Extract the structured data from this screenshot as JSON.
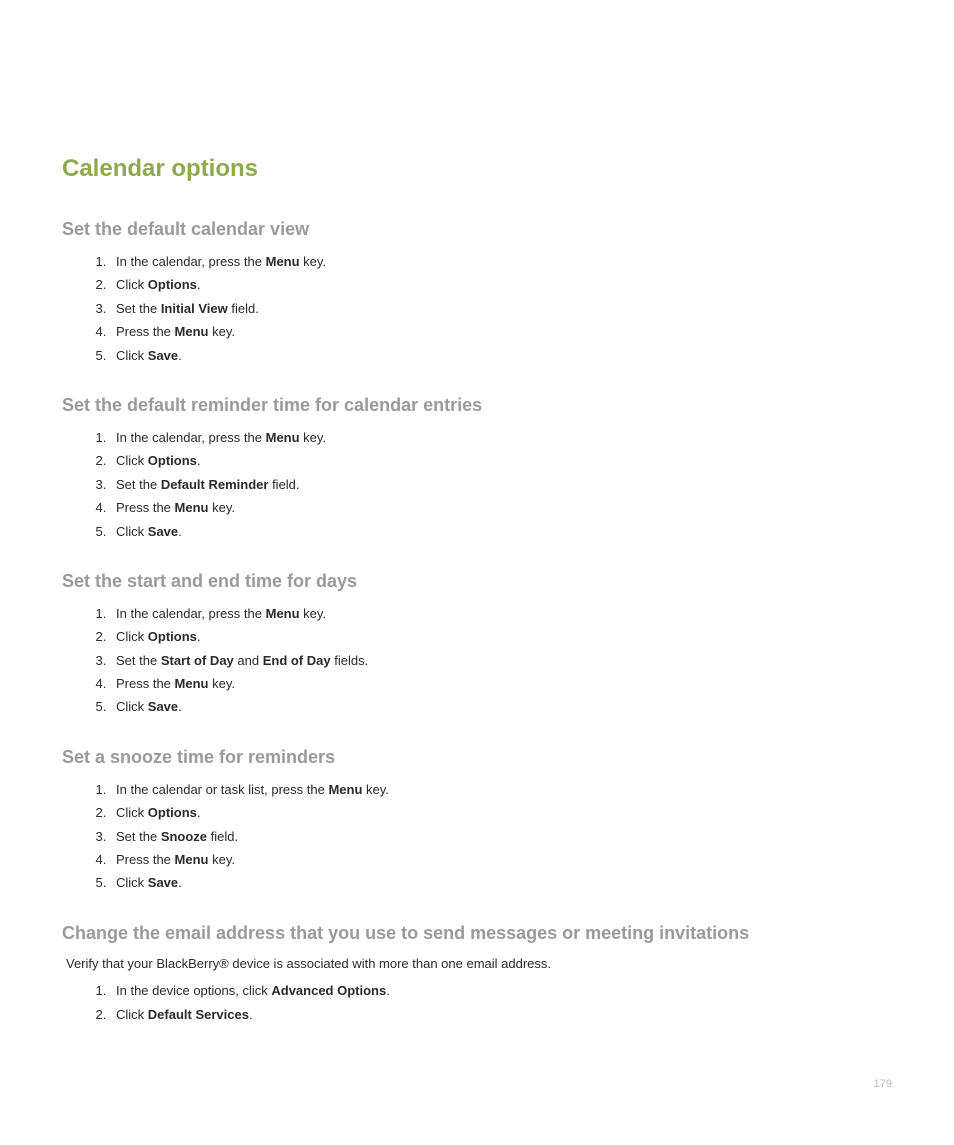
{
  "pageTitle": "Calendar options",
  "pageNumber": "179",
  "sections": [
    {
      "title": "Set the default calendar view",
      "intro": null,
      "steps": [
        [
          {
            "t": "In the calendar, press the "
          },
          {
            "t": "Menu",
            "b": true
          },
          {
            "t": " key."
          }
        ],
        [
          {
            "t": "Click "
          },
          {
            "t": "Options",
            "b": true
          },
          {
            "t": "."
          }
        ],
        [
          {
            "t": "Set the "
          },
          {
            "t": "Initial View",
            "b": true
          },
          {
            "t": " field."
          }
        ],
        [
          {
            "t": "Press the "
          },
          {
            "t": "Menu",
            "b": true
          },
          {
            "t": " key."
          }
        ],
        [
          {
            "t": "Click "
          },
          {
            "t": "Save",
            "b": true
          },
          {
            "t": "."
          }
        ]
      ]
    },
    {
      "title": "Set the default reminder time for calendar entries",
      "intro": null,
      "steps": [
        [
          {
            "t": "In the calendar, press the "
          },
          {
            "t": "Menu",
            "b": true
          },
          {
            "t": " key."
          }
        ],
        [
          {
            "t": "Click "
          },
          {
            "t": "Options",
            "b": true
          },
          {
            "t": "."
          }
        ],
        [
          {
            "t": "Set the "
          },
          {
            "t": "Default Reminder",
            "b": true
          },
          {
            "t": " field."
          }
        ],
        [
          {
            "t": "Press the "
          },
          {
            "t": "Menu",
            "b": true
          },
          {
            "t": " key."
          }
        ],
        [
          {
            "t": "Click "
          },
          {
            "t": "Save",
            "b": true
          },
          {
            "t": "."
          }
        ]
      ]
    },
    {
      "title": "Set the start and end time for days",
      "intro": null,
      "steps": [
        [
          {
            "t": "In the calendar, press the "
          },
          {
            "t": "Menu",
            "b": true
          },
          {
            "t": " key."
          }
        ],
        [
          {
            "t": "Click "
          },
          {
            "t": "Options",
            "b": true
          },
          {
            "t": "."
          }
        ],
        [
          {
            "t": "Set the "
          },
          {
            "t": "Start of Day",
            "b": true
          },
          {
            "t": " and "
          },
          {
            "t": "End of Day",
            "b": true
          },
          {
            "t": " fields."
          }
        ],
        [
          {
            "t": "Press the "
          },
          {
            "t": "Menu",
            "b": true
          },
          {
            "t": " key."
          }
        ],
        [
          {
            "t": "Click "
          },
          {
            "t": "Save",
            "b": true
          },
          {
            "t": "."
          }
        ]
      ]
    },
    {
      "title": "Set a snooze time for reminders",
      "intro": null,
      "steps": [
        [
          {
            "t": "In the calendar or task list, press the "
          },
          {
            "t": "Menu",
            "b": true
          },
          {
            "t": " key."
          }
        ],
        [
          {
            "t": "Click "
          },
          {
            "t": "Options",
            "b": true
          },
          {
            "t": "."
          }
        ],
        [
          {
            "t": "Set the "
          },
          {
            "t": "Snooze",
            "b": true
          },
          {
            "t": " field."
          }
        ],
        [
          {
            "t": "Press the "
          },
          {
            "t": "Menu",
            "b": true
          },
          {
            "t": " key."
          }
        ],
        [
          {
            "t": "Click "
          },
          {
            "t": "Save",
            "b": true
          },
          {
            "t": "."
          }
        ]
      ]
    },
    {
      "title": "Change the email address that you use to send messages or meeting invitations",
      "intro": "Verify that your BlackBerry® device is associated with more than one email address.",
      "steps": [
        [
          {
            "t": "In the device options, click "
          },
          {
            "t": "Advanced Options",
            "b": true
          },
          {
            "t": "."
          }
        ],
        [
          {
            "t": "Click "
          },
          {
            "t": "Default Services",
            "b": true
          },
          {
            "t": "."
          }
        ]
      ]
    }
  ]
}
